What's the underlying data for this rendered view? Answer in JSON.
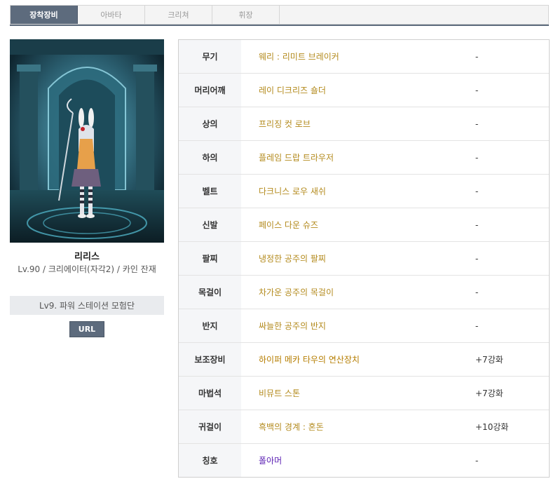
{
  "tabs": [
    {
      "label": "장착장비",
      "active": true
    },
    {
      "label": "아바타",
      "active": false
    },
    {
      "label": "크리쳐",
      "active": false
    },
    {
      "label": "휘장",
      "active": false
    }
  ],
  "character": {
    "name": "리리스",
    "info": "Lv.90 / 크리에이터(자각2) / 카인 잔재",
    "guild": "Lv9. 파워 스테이션 모험단",
    "url_label": "URL"
  },
  "equipment": [
    {
      "slot": "무기",
      "item": "웨리 : 리미트 브레이커",
      "enhance": "-"
    },
    {
      "slot": "머리어깨",
      "item": "레이 디크리즈 숄더",
      "enhance": "-"
    },
    {
      "slot": "상의",
      "item": "프리징 컷 로브",
      "enhance": "-"
    },
    {
      "slot": "하의",
      "item": "플레임 드랍 트라우저",
      "enhance": "-"
    },
    {
      "slot": "벨트",
      "item": "다크니스 로우 새쉬",
      "enhance": "-"
    },
    {
      "slot": "신발",
      "item": "페이스 다운 슈즈",
      "enhance": "-"
    },
    {
      "slot": "팔찌",
      "item": "냉정한 공주의 팔찌",
      "enhance": "-"
    },
    {
      "slot": "목걸이",
      "item": "차가운 공주의 목걸이",
      "enhance": "-"
    },
    {
      "slot": "반지",
      "item": "싸늘한 공주의 반지",
      "enhance": "-"
    },
    {
      "slot": "보조장비",
      "item": "하이퍼 메카 타우의 연산장치",
      "enhance": "+7강화"
    },
    {
      "slot": "마법석",
      "item": "비뮤트 스톤",
      "enhance": "+7강화"
    },
    {
      "slot": "귀걸이",
      "item": "흑백의 경계 : 혼돈",
      "enhance": "+10강화"
    },
    {
      "slot": "칭호",
      "item": "폴아머",
      "enhance": "-"
    }
  ],
  "colors": {
    "accent": "#5d6b7d",
    "item_gold": "#b38a1c",
    "item_purple": "#5b1fb3"
  }
}
